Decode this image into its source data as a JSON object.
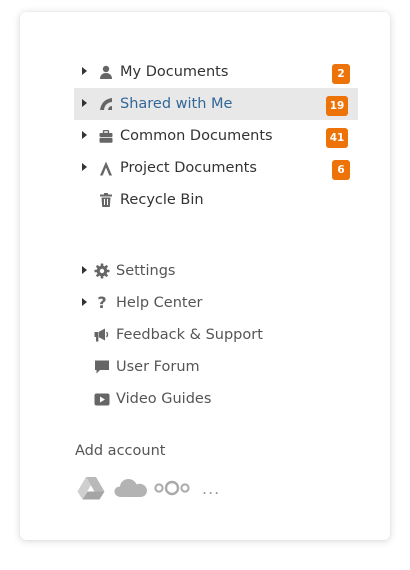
{
  "tree": [
    {
      "label": "My Documents",
      "icon": "person-icon",
      "badge": "2"
    },
    {
      "label": "Shared with Me",
      "icon": "shared-icon",
      "badge": "19",
      "selected": true
    },
    {
      "label": "Common Documents",
      "icon": "briefcase-icon",
      "badge": "41"
    },
    {
      "label": "Project Documents",
      "icon": "project-icon",
      "badge": "6"
    },
    {
      "label": "Recycle Bin",
      "icon": "trash-icon"
    }
  ],
  "secondary": [
    {
      "label": "Settings",
      "icon": "gear-icon"
    },
    {
      "label": "Help Center",
      "icon": "question-icon"
    },
    {
      "label": "Feedback & Support",
      "icon": "megaphone-icon"
    },
    {
      "label": "User Forum",
      "icon": "speech-bubble-icon"
    },
    {
      "label": "Video Guides",
      "icon": "play-icon"
    }
  ],
  "add_account": {
    "title": "Add account",
    "services": [
      "google-drive-icon",
      "cloud-icon",
      "nextcloud-icon"
    ],
    "more": "..."
  },
  "colors": {
    "badge": "#ed7309",
    "selected_text": "#316799",
    "selected_bg": "#e8e8e8",
    "muted_icon": "#a8a8a8"
  }
}
